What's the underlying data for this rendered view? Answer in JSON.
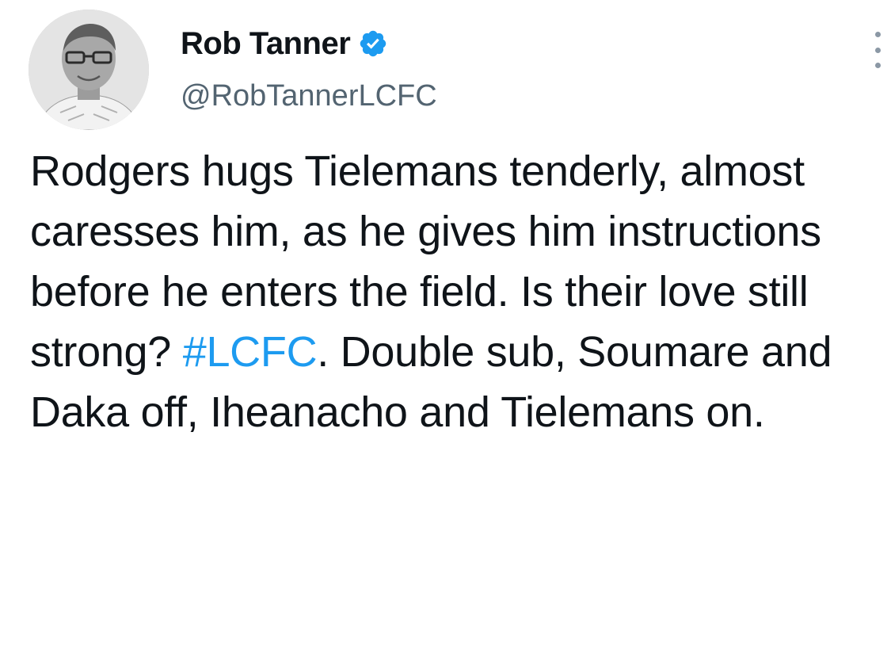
{
  "author": {
    "display_name": "Rob Tanner",
    "handle": "@RobTannerLCFC",
    "verified": true,
    "avatar_icon": "profile-photo"
  },
  "more_menu": {
    "icon": "more-vertical-icon"
  },
  "tweet": {
    "text_before_hashtag": "Rodgers hugs Tielemans tenderly, almost caresses him, as he gives him instructions before he enters the field. Is their love still strong? ",
    "hashtag": "#LCFC",
    "text_after_hashtag": ". Double sub, Soumare and Daka off, Iheanacho and Tielemans on."
  },
  "colors": {
    "link": "#1d9bf0",
    "verified_badge": "#1d9bf0",
    "secondary_text": "#536471",
    "primary_text": "#0f1419"
  }
}
